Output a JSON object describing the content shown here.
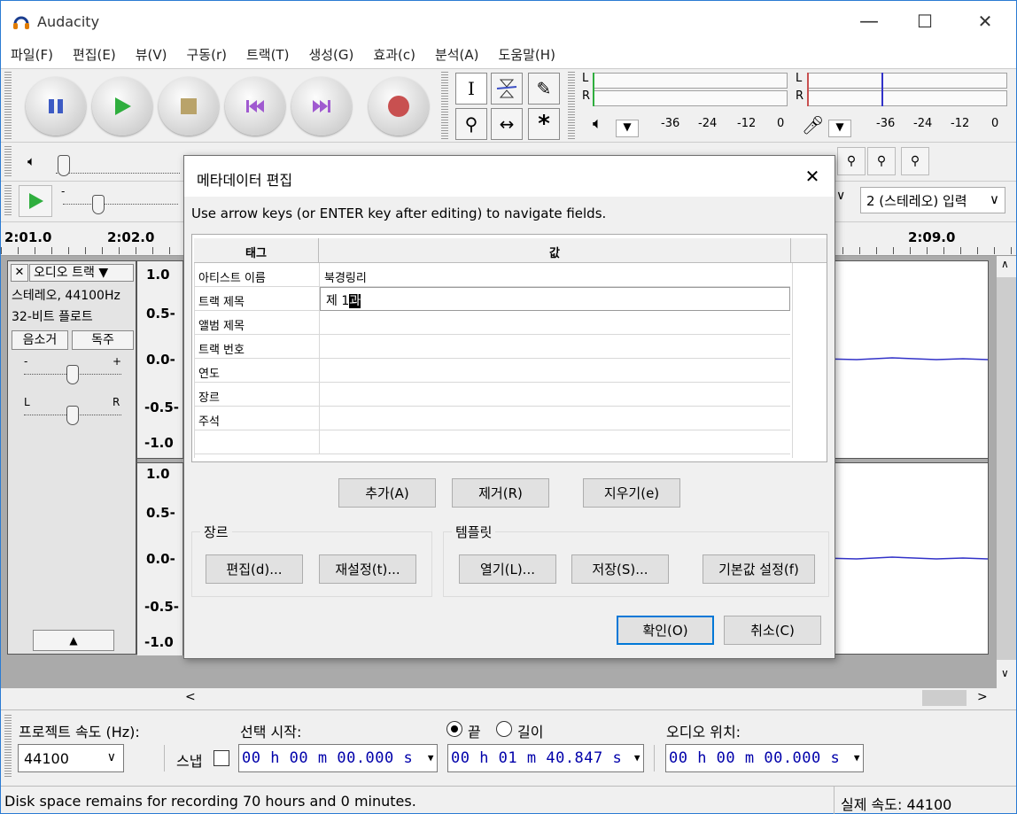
{
  "window": {
    "title": "Audacity",
    "minimize": "—",
    "maximize": "☐",
    "close": "✕"
  },
  "menu": [
    "파일(F)",
    "편집(E)",
    "뷰(V)",
    "구동(r)",
    "트랙(T)",
    "생성(G)",
    "효과(c)",
    "분석(A)",
    "도움말(H)"
  ],
  "meters": {
    "playback_ticks": [
      "-36",
      "-24",
      "-12",
      "0"
    ],
    "record_ticks": [
      "-36",
      "-24",
      "-12",
      "0"
    ],
    "left": "L",
    "right": "R"
  },
  "device": {
    "input_channels": "2 (스테레오) 입력"
  },
  "ruler": {
    "labels": [
      "2:01.0",
      "2:02.0",
      "2:09.0"
    ]
  },
  "track": {
    "close": "✕",
    "name": "오디오 트랙",
    "info1": "스테레오, 44100Hz",
    "info2": "32-비트 플로트",
    "mute": "음소거",
    "solo": "독주",
    "gain_minus": "-",
    "gain_plus": "+",
    "pan_left": "L",
    "pan_right": "R",
    "collapse": "▲",
    "scale_top": [
      "1.0",
      "0.5-",
      "0.0-",
      "-0.5-",
      "-1.0"
    ],
    "scale_bottom": [
      "1.0",
      "0.5-",
      "0.0-",
      "-0.5-",
      "-1.0"
    ]
  },
  "dialog": {
    "title": "메타데이터 편집",
    "close": "✕",
    "hint": "Use arrow keys (or ENTER key after editing) to navigate fields.",
    "col_tag": "태그",
    "col_value": "값",
    "rows": [
      {
        "tag": "아티스트 이름",
        "value": "북경링리"
      },
      {
        "tag": "트랙 제목",
        "value": "제 1",
        "value_selected": "과"
      },
      {
        "tag": "앨범 제목",
        "value": ""
      },
      {
        "tag": "트랙 번호",
        "value": ""
      },
      {
        "tag": "연도",
        "value": ""
      },
      {
        "tag": "장르",
        "value": ""
      },
      {
        "tag": "주석",
        "value": ""
      },
      {
        "tag": "",
        "value": ""
      }
    ],
    "add": "추가(A)",
    "remove": "제거(R)",
    "clear": "지우기(e)",
    "genre_group": "장르",
    "genre_edit": "편집(d)...",
    "genre_reset": "재설정(t)...",
    "template_group": "템플릿",
    "template_load": "열기(L)...",
    "template_save": "저장(S)...",
    "template_default": "기본값 설정(f)",
    "ok": "확인(O)",
    "cancel": "취소(C)"
  },
  "bottom": {
    "project_rate_label": "프로젝트 속도 (Hz):",
    "project_rate": "44100",
    "snap_label": "스냅",
    "selection_start_label": "선택 시작:",
    "selection_start": "00 h 00 m 00.000 s",
    "end_label": "끝",
    "length_label": "길이",
    "selection_end": "00 h 01 m 40.847 s",
    "audio_position_label": "오디오 위치:",
    "audio_position": "00 h 00 m 00.000 s"
  },
  "status": {
    "message": "Disk space remains for recording 70 hours and 0 minutes.",
    "actual_rate": "실제 속도: 44100"
  },
  "colors": {
    "accent": "#2b7bd3",
    "waveform": "#3232c8",
    "time_text": "#0000aa"
  }
}
